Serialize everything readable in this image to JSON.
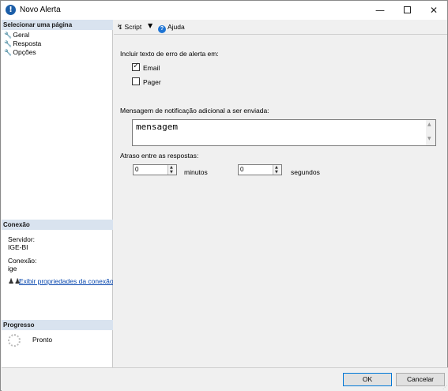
{
  "window": {
    "title": "Novo Alerta",
    "icon": "info-icon"
  },
  "left_panel": {
    "pages_header": "Selecionar uma página",
    "pages": [
      {
        "label": "Geral",
        "icon": "wrench-icon"
      },
      {
        "label": "Resposta",
        "icon": "wrench-icon"
      },
      {
        "label": "Opções",
        "icon": "wrench-icon"
      }
    ],
    "connection_header": "Conexão",
    "server_label": "Servidor:",
    "server_value": "IGE-BI",
    "connection_label": "Conexão:",
    "connection_value": "ige",
    "view_props_link": "Exibir propriedades da conexão",
    "progress_header": "Progresso",
    "progress_status": "Pronto"
  },
  "toolbar": {
    "script_label": "Script",
    "help_label": "Ajuda"
  },
  "options": {
    "include_error_text_label": "Incluir texto de erro de alerta em:",
    "email_label": "Email",
    "email_checked": true,
    "pager_label": "Pager",
    "pager_checked": false,
    "notification_message_label": "Mensagem de notificação adicional a ser enviada:",
    "notification_message_value": "mensagem",
    "delay_label": "Atraso entre as respostas:",
    "minutes_value": "0",
    "minutes_label": "minutos",
    "seconds_value": "0",
    "seconds_label": "segundos"
  },
  "footer": {
    "ok_label": "OK",
    "cancel_label": "Cancelar"
  }
}
